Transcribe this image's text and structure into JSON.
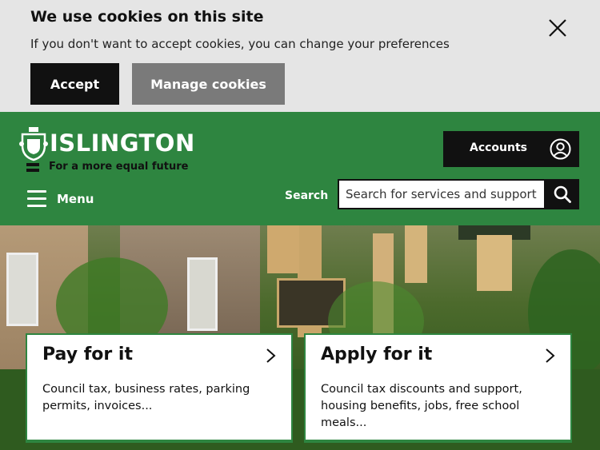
{
  "cookie_banner": {
    "title": "We use cookies on this site",
    "text": "If you don't want to accept cookies, you can change your preferences",
    "accept_label": "Accept",
    "manage_label": "Manage cookies",
    "close_icon": "close-icon"
  },
  "header": {
    "logo_text": "ISLINGTON",
    "tagline": "For a more equal future",
    "accounts_label": "Accounts",
    "accounts_icon": "user-icon",
    "menu_label": "Menu",
    "search_label": "Search",
    "search_placeholder": "Search for services and support",
    "search_icon": "search-icon",
    "brand_color": "#2e8540"
  },
  "cards": [
    {
      "title": "Pay for it",
      "description": "Council tax, business rates, parking permits, invoices...",
      "icon": "chevron-right-icon"
    },
    {
      "title": "Apply for it",
      "description": "Council tax discounts and support, housing benefits, jobs, free school meals...",
      "icon": "chevron-right-icon"
    }
  ]
}
